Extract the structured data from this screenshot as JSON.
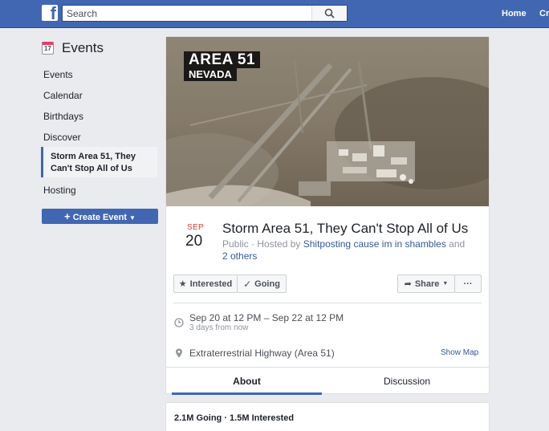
{
  "header": {
    "logo": "f",
    "search_placeholder": "Search",
    "nav_home": "Home",
    "nav_create": "Create"
  },
  "sidebar": {
    "title": "Events",
    "calendar_icon_day": "17",
    "items": [
      "Events",
      "Calendar",
      "Birthdays",
      "Discover"
    ],
    "active_item": "Storm Area 51, They Can't Stop All of Us",
    "hosting": "Hosting",
    "create_button": "Create Event"
  },
  "event": {
    "cover_text_line1": "AREA 51",
    "cover_text_line2": "NEVADA",
    "month": "SEP",
    "day": "20",
    "title": "Storm Area 51, They Can't Stop All of Us",
    "visibility": "Public",
    "hosted_by_prefix": "Hosted by",
    "host_name": "Shitposting cause im in shambles",
    "and_text": "and",
    "others_link": "2 others",
    "buttons": {
      "interested": "Interested",
      "going": "Going",
      "share": "Share",
      "more": "···"
    },
    "time": "Sep 20 at 12 PM – Sep 22 at 12 PM",
    "time_relative": "3 days from now",
    "location": "Extraterrestrial Highway (Area 51)",
    "show_map": "Show Map",
    "tabs": [
      "About",
      "Discussion"
    ],
    "stats": "2.1M Going · 1.5M Interested"
  },
  "colors": {
    "brand_blue": "#4267b2",
    "month_red": "#e03b2f",
    "link_blue": "#365899"
  }
}
